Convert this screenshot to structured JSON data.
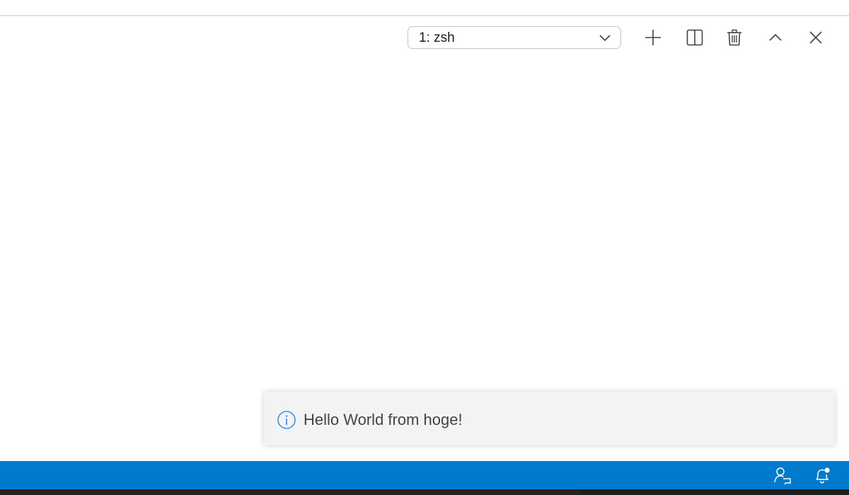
{
  "terminal": {
    "selected_terminal": "1: zsh",
    "actions": {
      "new_terminal": "plus-icon",
      "split_terminal": "split-icon",
      "kill_terminal": "trash-icon",
      "maximize_panel": "chevron-up-icon",
      "close_panel": "close-icon"
    }
  },
  "notification": {
    "icon": "info-icon",
    "message": "Hello World from hoge!"
  },
  "status_bar": {
    "items": [
      {
        "icon": "feedback-icon"
      },
      {
        "icon": "notification-bell-icon"
      }
    ]
  },
  "colors": {
    "status_bar": "#007acc",
    "notification_bg": "#f3f3f3",
    "info_accent": "#3794ff",
    "toolbar_icon": "#424242"
  }
}
